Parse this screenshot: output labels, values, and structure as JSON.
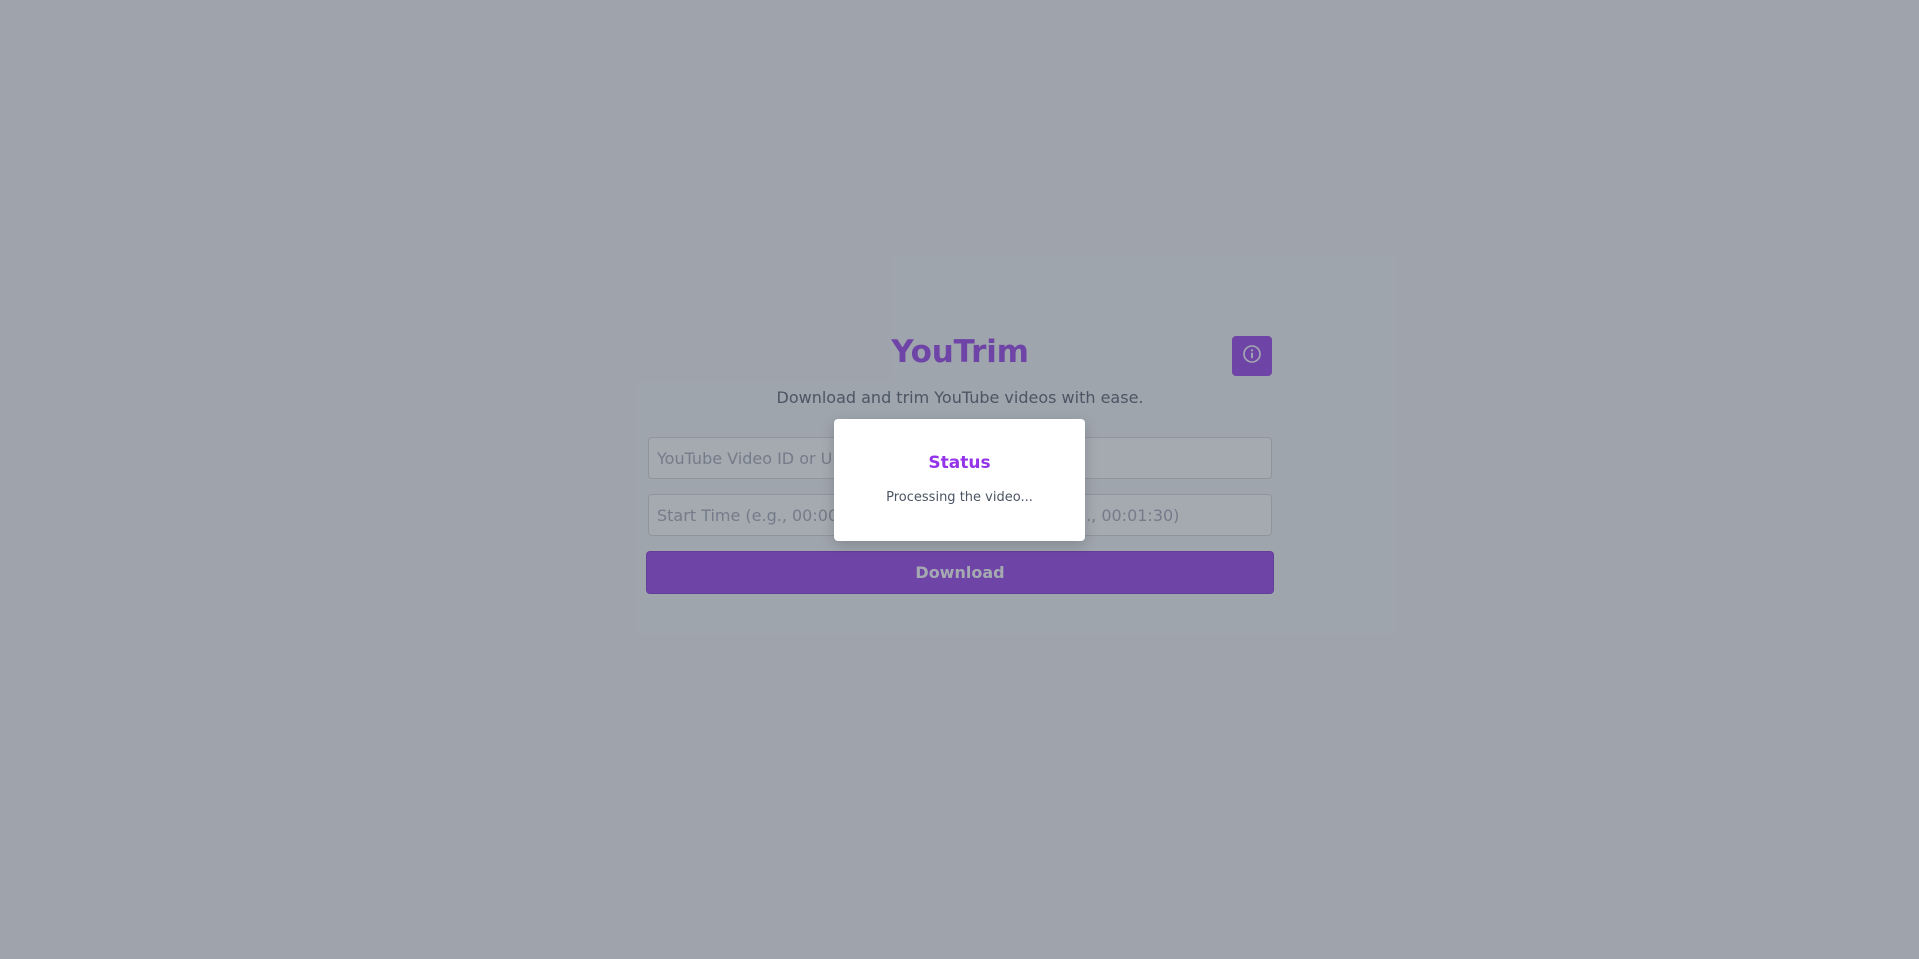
{
  "app": {
    "title": "YouTrim",
    "subtitle": "Download and trim YouTube videos with ease.",
    "info_icon": "info-circle-icon"
  },
  "form": {
    "url_placeholder": "YouTube Video ID or URL",
    "start_placeholder": "Start Time (e.g., 00:00:30)",
    "end_placeholder": "End Time (e.g., 00:01:30)",
    "download_label": "Download"
  },
  "modal": {
    "title": "Status",
    "message": "Processing the video..."
  },
  "colors": {
    "accent": "#9333ea",
    "overlay": "#6b7280"
  }
}
